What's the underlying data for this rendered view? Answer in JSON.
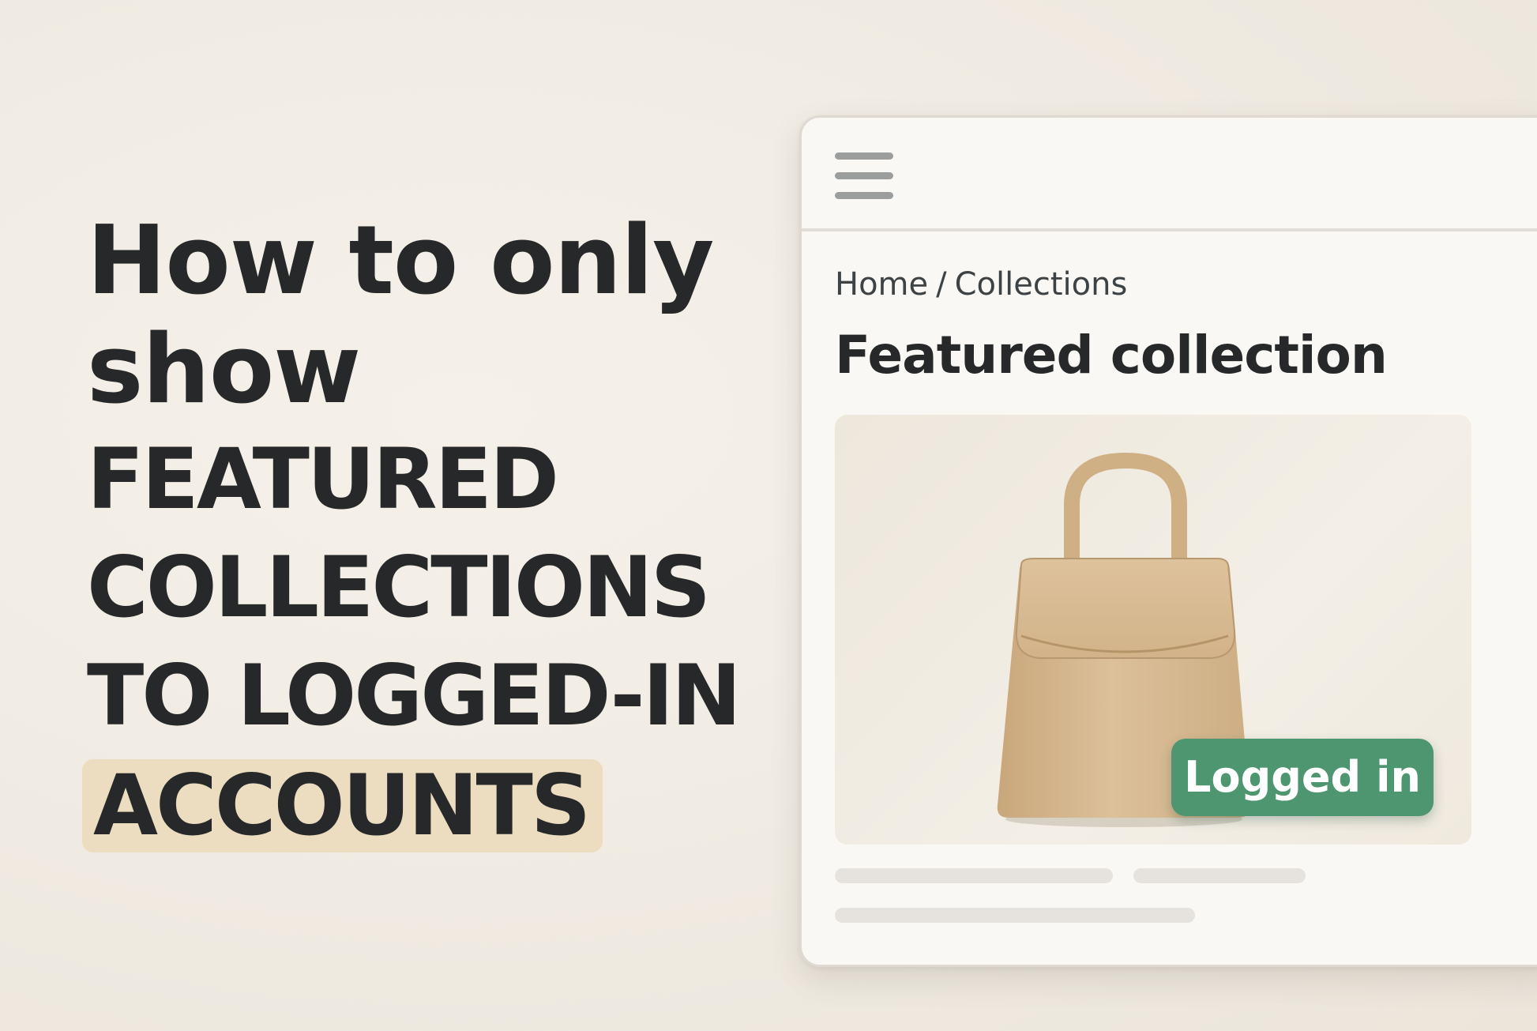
{
  "headline": {
    "line1": "How to only",
    "line2": "show",
    "line3": "FEATURED",
    "line4": "COLLECTIONS",
    "line5": "TO LOGGED-IN",
    "line6": "ACCOUNTS"
  },
  "window": {
    "menu_icon": "hamburger-menu-icon",
    "breadcrumb": {
      "home": "Home",
      "separator": "/",
      "current": "Collections"
    },
    "page_title": "Featured collection",
    "product": {
      "image": "beige-handbag",
      "badge": "Logged in"
    }
  },
  "colors": {
    "background": "#f1ece3",
    "text": "#262829",
    "highlight": "#ecdcc0",
    "badge": "#4e9670",
    "bag": "#d6b88f"
  }
}
